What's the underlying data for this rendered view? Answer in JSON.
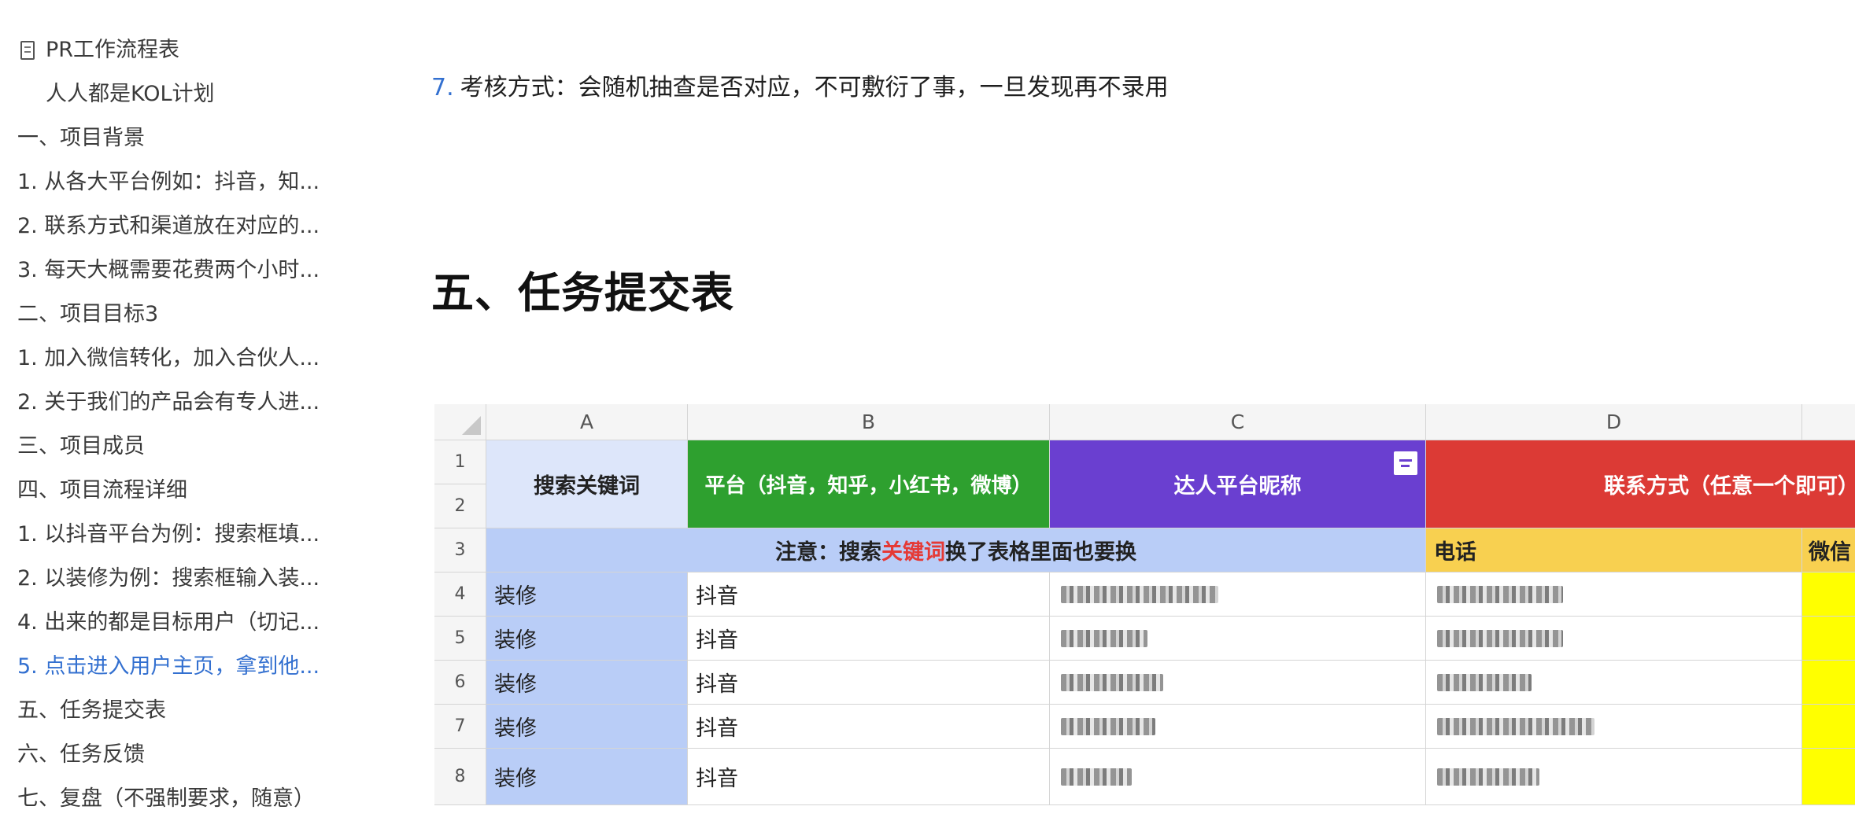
{
  "toc": {
    "items": [
      {
        "label": "PR工作流程表",
        "level": "doc"
      },
      {
        "label": "人人都是KOL计划",
        "level": "root"
      },
      {
        "label": "一、项目背景",
        "level": "l0"
      },
      {
        "label": "1. 从各大平台例如：抖音，知...",
        "level": "l0"
      },
      {
        "label": "2. 联系方式和渠道放在对应的...",
        "level": "l0"
      },
      {
        "label": "3. 每天大概需要花费两个小时...",
        "level": "l0"
      },
      {
        "label": "二、项目目标3",
        "level": "l0"
      },
      {
        "label": "1. 加入微信转化，加入合伙人...",
        "level": "l0"
      },
      {
        "label": "2. 关于我们的产品会有专人进...",
        "level": "l0"
      },
      {
        "label": "三、项目成员",
        "level": "l0"
      },
      {
        "label": "四、项目流程详细",
        "level": "l0"
      },
      {
        "label": "1. 以抖音平台为例：搜索框填...",
        "level": "l0"
      },
      {
        "label": "2. 以装修为例：搜索框输入装...",
        "level": "l0"
      },
      {
        "label": "4. 出来的都是目标用户（切记...",
        "level": "l0"
      },
      {
        "label": "5. 点击进入用户主页，拿到他...",
        "level": "l0",
        "active": true
      },
      {
        "label": "五、任务提交表",
        "level": "l0"
      },
      {
        "label": "六、任务反馈",
        "level": "l0"
      },
      {
        "label": "七、复盘（不强制要求，随意）",
        "level": "l0"
      }
    ]
  },
  "main": {
    "list_num": "7.",
    "list_text": "考核方式：会随机抽查是否对应，不可敷衍了事，一旦发现再不录用",
    "section_title": "五、任务提交表"
  },
  "sheet": {
    "columns": [
      "A",
      "B",
      "C",
      "D"
    ],
    "header_a": "搜索关键词",
    "header_b": "平台（抖音，知乎，小红书，微博）",
    "header_c": "达人平台昵称",
    "header_d": "联系方式（任意一个即可）",
    "note_prefix": "注意：搜索",
    "note_highlight": "关键词",
    "note_suffix": "换了表格里面也要换",
    "phone_label": "电话",
    "wechat_label": "微信",
    "row_numbers": [
      "1",
      "2",
      "3",
      "4",
      "5",
      "6",
      "7",
      "8"
    ],
    "rows": [
      {
        "keyword": "装修",
        "platform": "抖音"
      },
      {
        "keyword": "装修",
        "platform": "抖音"
      },
      {
        "keyword": "装修",
        "platform": "抖音"
      },
      {
        "keyword": "装修",
        "platform": "抖音"
      },
      {
        "keyword": "装修",
        "platform": "抖音"
      }
    ],
    "colors": {
      "a_header": "#dde6fa",
      "a_body": "#b9cdf7",
      "b_header": "#2ea02f",
      "c_header": "#6a3fd0",
      "d_header": "#dc3a35",
      "note_row": "#b9cdf7",
      "phone": "#f8d050",
      "wechat_yellow": "#ffff00"
    }
  }
}
